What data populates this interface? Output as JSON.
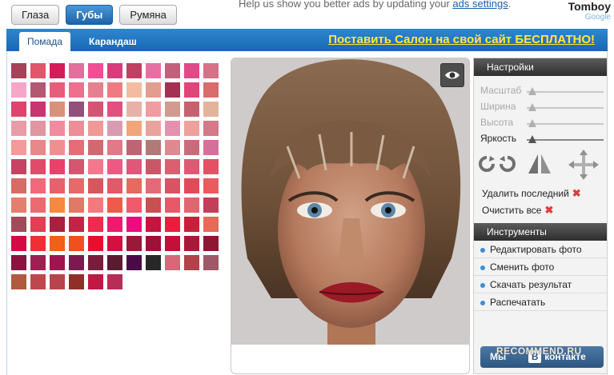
{
  "top_buttons": [
    {
      "label": "Глаза"
    },
    {
      "label": "Губы",
      "active": true
    },
    {
      "label": "Румяна"
    }
  ],
  "ad": {
    "text": "Help us show you better ads by updating your ",
    "link": "ads settings",
    "tail": "."
  },
  "brand": {
    "name": "Tomboy",
    "sub": "Google"
  },
  "tabs": [
    {
      "label": "Помада"
    },
    {
      "label": "Карандаш"
    }
  ],
  "promo": "Поставить Салон на свой сайт БЕСПЛАТНО!",
  "palette": [
    "#a8415a",
    "#e0576a",
    "#d41c5a",
    "#e46e9c",
    "#f24e94",
    "#d63d7a",
    "#c13f62",
    "#e96fa2",
    "#c2607c",
    "#e04a88",
    "#d67188",
    "#f6a6c8",
    "#b35872",
    "#e85d7c",
    "#ee6f8e",
    "#e48090",
    "#ef7b82",
    "#f3bca0",
    "#e29c90",
    "#a43052",
    "#e0457a",
    "#d96c6c",
    "#e1436e",
    "#c9356e",
    "#d8927a",
    "#93507a",
    "#d65472",
    "#e25080",
    "#e9b0a8",
    "#ef9ca2",
    "#d29a90",
    "#c46270",
    "#e3b49c",
    "#e79ca8",
    "#e095a0",
    "#f28aa0",
    "#ee8c98",
    "#f19898",
    "#d89cb0",
    "#f3a478",
    "#e8a49a",
    "#e690b0",
    "#f0a09c",
    "#d4788a",
    "#f49a9c",
    "#e88888",
    "#ee9090",
    "#e66c78",
    "#d06a70",
    "#e07a88",
    "#c06474",
    "#b07a76",
    "#e08890",
    "#c86c7c",
    "#d6709a",
    "#c54466",
    "#e24a6a",
    "#ea406a",
    "#d25870",
    "#f2788e",
    "#ea5a82",
    "#e0577a",
    "#c85868",
    "#d86070",
    "#dc5a74",
    "#e05264",
    "#d66c66",
    "#f26a7a",
    "#e8606c",
    "#e66a6a",
    "#d6585e",
    "#e05a6a",
    "#e66a5e",
    "#e46a78",
    "#d85464",
    "#e24a5a",
    "#ea5a5e",
    "#e67e70",
    "#ec6a70",
    "#f48a3e",
    "#e07a66",
    "#f27a7c",
    "#f05a4a",
    "#f05a6c",
    "#c85050",
    "#e85868",
    "#e06672",
    "#c33e58",
    "#a24a5a",
    "#e23e54",
    "#a82040",
    "#c22446",
    "#ee2a4e",
    "#ee1a6e",
    "#e80e7e",
    "#c21640",
    "#ee1c3c",
    "#c8203a",
    "#e66a5a",
    "#d40a44",
    "#ee3034",
    "#f0601a",
    "#f05020",
    "#e80e2e",
    "#d41040",
    "#9a1838",
    "#9e1038",
    "#c41038",
    "#a81838",
    "#8e1634",
    "#8a1440",
    "#9e2052",
    "#a01450",
    "#7a1a4e",
    "#7a1c3c",
    "#5a1a30",
    "#4a0a48",
    "#282828",
    "#d86878",
    "#b0424a",
    "#9e5868",
    "#b05a40",
    "#c0464e",
    "#b8444c",
    "#8e3028",
    "#c21844",
    "#b82c58"
  ],
  "panel": {
    "settings_title": "Настройки",
    "sliders": [
      {
        "label": "Масштаб",
        "active": false
      },
      {
        "label": "Ширина",
        "active": false
      },
      {
        "label": "Высота",
        "active": false
      },
      {
        "label": "Яркость",
        "active": true
      }
    ],
    "actions": [
      {
        "label": "Удалить последний"
      },
      {
        "label": "Очистить все"
      }
    ],
    "tools_title": "Инструменты",
    "menu": [
      {
        "label": "Редактировать фото"
      },
      {
        "label": "Сменить фото"
      },
      {
        "label": "Скачать результат"
      },
      {
        "label": "Распечатать"
      }
    ],
    "vk_left": "Мы",
    "vk_right": "контакте"
  },
  "watermark": "RECOMMEND.RU",
  "colors": {
    "accent": "#1d63a8",
    "promo": "#ffea3a",
    "delete_x": "#e53935"
  }
}
